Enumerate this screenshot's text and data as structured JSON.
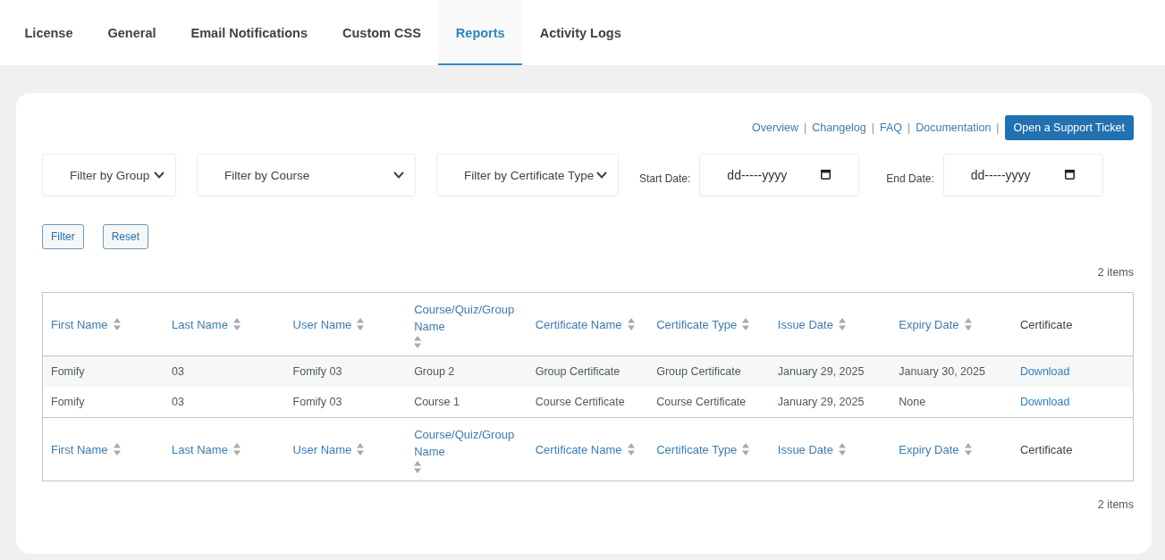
{
  "tabs": [
    {
      "label": "License",
      "selected": false
    },
    {
      "label": "General",
      "selected": false
    },
    {
      "label": "Email Notifications",
      "selected": false
    },
    {
      "label": "Custom CSS",
      "selected": false
    },
    {
      "label": "Reports",
      "selected": true
    },
    {
      "label": "Activity Logs",
      "selected": false
    }
  ],
  "help_links": {
    "items": [
      "Overview",
      "Changelog",
      "FAQ",
      "Documentation"
    ],
    "separator": "|"
  },
  "support_button": "Open a Support Ticket",
  "filters": [
    {
      "kind": "select",
      "value": "Filter by Group"
    },
    {
      "kind": "select",
      "value": "Filter by Course"
    },
    {
      "kind": "select",
      "value": "Filter by Certificate Type"
    },
    {
      "kind": "date",
      "label": "Start Date:",
      "placeholder": "dd-----yyyy"
    },
    {
      "kind": "date",
      "label": "End Date:",
      "placeholder": "dd-----yyyy"
    }
  ],
  "actions": [
    "Filter",
    "Reset"
  ],
  "item_count_top": "2 items",
  "table": {
    "columns": [
      {
        "label": "First Name",
        "sortable": true,
        "kind": "text"
      },
      {
        "label": "Last Name",
        "sortable": true,
        "kind": "text"
      },
      {
        "label": "User Name",
        "sortable": true,
        "kind": "text"
      },
      {
        "label": "Course/Quiz/Group Name",
        "sortable": true,
        "kind": "text"
      },
      {
        "label": "Certificate Name",
        "sortable": true,
        "kind": "text"
      },
      {
        "label": "Certificate Type",
        "sortable": true,
        "kind": "text"
      },
      {
        "label": "Issue Date",
        "sortable": true,
        "kind": "text"
      },
      {
        "label": "Expiry Date",
        "sortable": true,
        "kind": "text"
      },
      {
        "label": "Certificate",
        "sortable": false,
        "kind": "link"
      }
    ],
    "rows": [
      {
        "cells": [
          "Fomify",
          "03",
          "Fomify 03",
          "Group 2",
          "Group Certificate",
          "Group Certificate",
          "January 29, 2025",
          "January 30, 2025",
          "Download"
        ]
      },
      {
        "cells": [
          "Fomify",
          "03",
          "Fomify 03",
          "Course 1",
          "Course Certificate",
          "Course Certificate",
          "January 29, 2025",
          "None",
          "Download"
        ]
      }
    ],
    "footer_columns": [
      {
        "label": "First Name",
        "sortable": true
      },
      {
        "label": "Last Name",
        "sortable": true
      },
      {
        "label": "User Name",
        "sortable": true
      },
      {
        "label": "Course/Quiz/Group Name",
        "sortable": true
      },
      {
        "label": "Certificate Name",
        "sortable": true
      },
      {
        "label": "Certificate Type",
        "sortable": true
      },
      {
        "label": "Issue Date",
        "sortable": true
      },
      {
        "label": "Expiry Date",
        "sortable": true
      },
      {
        "label": "Certificate",
        "sortable": false
      }
    ]
  },
  "item_count_bottom": "2 items"
}
